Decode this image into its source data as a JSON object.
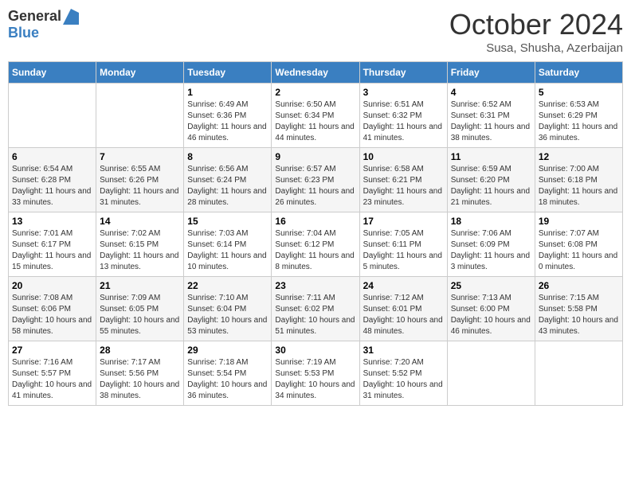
{
  "header": {
    "logo_general": "General",
    "logo_blue": "Blue",
    "month_title": "October 2024",
    "subtitle": "Susa, Shusha, Azerbaijan"
  },
  "days_of_week": [
    "Sunday",
    "Monday",
    "Tuesday",
    "Wednesday",
    "Thursday",
    "Friday",
    "Saturday"
  ],
  "weeks": [
    [
      {
        "day": "",
        "sunrise": "",
        "sunset": "",
        "daylight": ""
      },
      {
        "day": "",
        "sunrise": "",
        "sunset": "",
        "daylight": ""
      },
      {
        "day": "1",
        "sunrise": "Sunrise: 6:49 AM",
        "sunset": "Sunset: 6:36 PM",
        "daylight": "Daylight: 11 hours and 46 minutes."
      },
      {
        "day": "2",
        "sunrise": "Sunrise: 6:50 AM",
        "sunset": "Sunset: 6:34 PM",
        "daylight": "Daylight: 11 hours and 44 minutes."
      },
      {
        "day": "3",
        "sunrise": "Sunrise: 6:51 AM",
        "sunset": "Sunset: 6:32 PM",
        "daylight": "Daylight: 11 hours and 41 minutes."
      },
      {
        "day": "4",
        "sunrise": "Sunrise: 6:52 AM",
        "sunset": "Sunset: 6:31 PM",
        "daylight": "Daylight: 11 hours and 38 minutes."
      },
      {
        "day": "5",
        "sunrise": "Sunrise: 6:53 AM",
        "sunset": "Sunset: 6:29 PM",
        "daylight": "Daylight: 11 hours and 36 minutes."
      }
    ],
    [
      {
        "day": "6",
        "sunrise": "Sunrise: 6:54 AM",
        "sunset": "Sunset: 6:28 PM",
        "daylight": "Daylight: 11 hours and 33 minutes."
      },
      {
        "day": "7",
        "sunrise": "Sunrise: 6:55 AM",
        "sunset": "Sunset: 6:26 PM",
        "daylight": "Daylight: 11 hours and 31 minutes."
      },
      {
        "day": "8",
        "sunrise": "Sunrise: 6:56 AM",
        "sunset": "Sunset: 6:24 PM",
        "daylight": "Daylight: 11 hours and 28 minutes."
      },
      {
        "day": "9",
        "sunrise": "Sunrise: 6:57 AM",
        "sunset": "Sunset: 6:23 PM",
        "daylight": "Daylight: 11 hours and 26 minutes."
      },
      {
        "day": "10",
        "sunrise": "Sunrise: 6:58 AM",
        "sunset": "Sunset: 6:21 PM",
        "daylight": "Daylight: 11 hours and 23 minutes."
      },
      {
        "day": "11",
        "sunrise": "Sunrise: 6:59 AM",
        "sunset": "Sunset: 6:20 PM",
        "daylight": "Daylight: 11 hours and 21 minutes."
      },
      {
        "day": "12",
        "sunrise": "Sunrise: 7:00 AM",
        "sunset": "Sunset: 6:18 PM",
        "daylight": "Daylight: 11 hours and 18 minutes."
      }
    ],
    [
      {
        "day": "13",
        "sunrise": "Sunrise: 7:01 AM",
        "sunset": "Sunset: 6:17 PM",
        "daylight": "Daylight: 11 hours and 15 minutes."
      },
      {
        "day": "14",
        "sunrise": "Sunrise: 7:02 AM",
        "sunset": "Sunset: 6:15 PM",
        "daylight": "Daylight: 11 hours and 13 minutes."
      },
      {
        "day": "15",
        "sunrise": "Sunrise: 7:03 AM",
        "sunset": "Sunset: 6:14 PM",
        "daylight": "Daylight: 11 hours and 10 minutes."
      },
      {
        "day": "16",
        "sunrise": "Sunrise: 7:04 AM",
        "sunset": "Sunset: 6:12 PM",
        "daylight": "Daylight: 11 hours and 8 minutes."
      },
      {
        "day": "17",
        "sunrise": "Sunrise: 7:05 AM",
        "sunset": "Sunset: 6:11 PM",
        "daylight": "Daylight: 11 hours and 5 minutes."
      },
      {
        "day": "18",
        "sunrise": "Sunrise: 7:06 AM",
        "sunset": "Sunset: 6:09 PM",
        "daylight": "Daylight: 11 hours and 3 minutes."
      },
      {
        "day": "19",
        "sunrise": "Sunrise: 7:07 AM",
        "sunset": "Sunset: 6:08 PM",
        "daylight": "Daylight: 11 hours and 0 minutes."
      }
    ],
    [
      {
        "day": "20",
        "sunrise": "Sunrise: 7:08 AM",
        "sunset": "Sunset: 6:06 PM",
        "daylight": "Daylight: 10 hours and 58 minutes."
      },
      {
        "day": "21",
        "sunrise": "Sunrise: 7:09 AM",
        "sunset": "Sunset: 6:05 PM",
        "daylight": "Daylight: 10 hours and 55 minutes."
      },
      {
        "day": "22",
        "sunrise": "Sunrise: 7:10 AM",
        "sunset": "Sunset: 6:04 PM",
        "daylight": "Daylight: 10 hours and 53 minutes."
      },
      {
        "day": "23",
        "sunrise": "Sunrise: 7:11 AM",
        "sunset": "Sunset: 6:02 PM",
        "daylight": "Daylight: 10 hours and 51 minutes."
      },
      {
        "day": "24",
        "sunrise": "Sunrise: 7:12 AM",
        "sunset": "Sunset: 6:01 PM",
        "daylight": "Daylight: 10 hours and 48 minutes."
      },
      {
        "day": "25",
        "sunrise": "Sunrise: 7:13 AM",
        "sunset": "Sunset: 6:00 PM",
        "daylight": "Daylight: 10 hours and 46 minutes."
      },
      {
        "day": "26",
        "sunrise": "Sunrise: 7:15 AM",
        "sunset": "Sunset: 5:58 PM",
        "daylight": "Daylight: 10 hours and 43 minutes."
      }
    ],
    [
      {
        "day": "27",
        "sunrise": "Sunrise: 7:16 AM",
        "sunset": "Sunset: 5:57 PM",
        "daylight": "Daylight: 10 hours and 41 minutes."
      },
      {
        "day": "28",
        "sunrise": "Sunrise: 7:17 AM",
        "sunset": "Sunset: 5:56 PM",
        "daylight": "Daylight: 10 hours and 38 minutes."
      },
      {
        "day": "29",
        "sunrise": "Sunrise: 7:18 AM",
        "sunset": "Sunset: 5:54 PM",
        "daylight": "Daylight: 10 hours and 36 minutes."
      },
      {
        "day": "30",
        "sunrise": "Sunrise: 7:19 AM",
        "sunset": "Sunset: 5:53 PM",
        "daylight": "Daylight: 10 hours and 34 minutes."
      },
      {
        "day": "31",
        "sunrise": "Sunrise: 7:20 AM",
        "sunset": "Sunset: 5:52 PM",
        "daylight": "Daylight: 10 hours and 31 minutes."
      },
      {
        "day": "",
        "sunrise": "",
        "sunset": "",
        "daylight": ""
      },
      {
        "day": "",
        "sunrise": "",
        "sunset": "",
        "daylight": ""
      }
    ]
  ]
}
